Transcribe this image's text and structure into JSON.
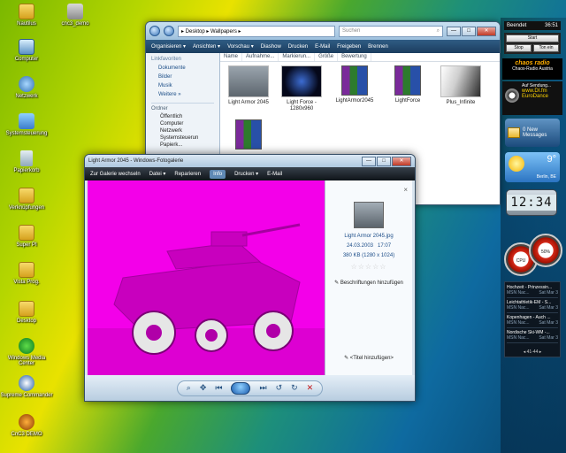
{
  "desktop_icons": [
    {
      "label": "Nautilus",
      "icon": "folder-icon"
    },
    {
      "label": "cnc3_demo",
      "icon": "shortcut-icon"
    },
    {
      "label": "Computer",
      "icon": "computer-icon"
    },
    {
      "label": "Netzwerk",
      "icon": "network-icon"
    },
    {
      "label": "Systemsteuerung",
      "icon": "control-panel-icon"
    },
    {
      "label": "Papierkorb",
      "icon": "recycle-bin-icon"
    },
    {
      "label": "Verknüpfungen",
      "icon": "folder-icon"
    },
    {
      "label": "Super PI",
      "icon": "folder-icon"
    },
    {
      "label": "Vista Prog.",
      "icon": "folder-icon"
    },
    {
      "label": "Desktop",
      "icon": "folder-icon"
    },
    {
      "label": "Windows Media Center",
      "icon": "media-center-icon"
    },
    {
      "label": "Supreme Commander",
      "icon": "game-icon"
    },
    {
      "label": "CnC3 DEMO",
      "icon": "game-icon"
    }
  ],
  "explorer": {
    "address": "▸ Desktop ▸ Wallpapers ▸",
    "search_placeholder": "Suchen",
    "toolbar": [
      "Organisieren ▾",
      "Ansichten ▾",
      "Vorschau ▾",
      "Diashow",
      "Drucken",
      "E-Mail",
      "Freigeben",
      "Brennen"
    ],
    "nav": {
      "favorites_header": "Linkfavoriten",
      "links": [
        "Dokumente",
        "Bilder",
        "Musik",
        "Weitere »"
      ],
      "folders_header": "Ordner",
      "tree": [
        "Öffentlich",
        "Computer",
        "Netzwerk",
        "Systemsteuerun",
        "Papierk..."
      ]
    },
    "columns": [
      "Name",
      "Aufnahme...",
      "Markierun...",
      "Größe",
      "Bewertung"
    ],
    "files": [
      {
        "name": "Light Armor 2045",
        "thumb": "tank"
      },
      {
        "name": "Light Force - 1280x960",
        "thumb": "space"
      },
      {
        "name": "LightArmor2045",
        "thumb": "rar"
      },
      {
        "name": "LightForce",
        "thumb": "rar"
      },
      {
        "name": "Plus_Infinite",
        "thumb": "grey"
      },
      {
        "name": "",
        "thumb": "rar"
      }
    ],
    "controls": {
      "min": "—",
      "max": "□",
      "close": "✕"
    }
  },
  "gallery": {
    "title": "Light Armor 2045 - Windows-Fotogalerie",
    "menu": {
      "back": "Zur Galerie wechseln",
      "file": "Datei ▾",
      "fix": "Reparieren",
      "info": "Info",
      "print": "Drucken ▾",
      "email": "E-Mail"
    },
    "info": {
      "filename": "Light Armor 2045.jpg",
      "date": "24.03.2003",
      "time": "17:07",
      "size": "380 KB (1280 x 1024)",
      "rating": 0,
      "add_tags": "Beschriftungen hinzufügen",
      "add_title": "<Titel hinzufügen>"
    },
    "controls": {
      "min": "—",
      "max": "□",
      "close": "✕"
    }
  },
  "sidebar": {
    "top_clock": {
      "label": "Beendet",
      "time": "36:51"
    },
    "start_gadget": {
      "start": "Start",
      "stop": "Stop",
      "tone": "Ton ein"
    },
    "radio": {
      "title": "chaos radio",
      "subtitle": "Chaos-Radio Austria"
    },
    "difm": {
      "pre": "Auf Sendung...",
      "station": "www.DI.fm EuroDance"
    },
    "mail": {
      "count": "0 New",
      "label": "Messages"
    },
    "weather": {
      "temp": "9°",
      "city": "Berlin, BE"
    },
    "clock_digital": "12:34",
    "meters": [
      "CPU",
      "50%"
    ],
    "news": [
      {
        "title": "Hochzeit - Prinzessin...",
        "source": "MSN Nac...",
        "date": "Sat Mar 3"
      },
      {
        "title": "Leichtathletik-EM - S...",
        "source": "MSN Nac...",
        "date": "Sat Mar 3"
      },
      {
        "title": "Kopenhagen - Auch ...",
        "source": "MSN Nac...",
        "date": "Sat Mar 3"
      },
      {
        "title": "Nordische Ski-WM -...",
        "source": "MSN Nac...",
        "date": "Sat Mar 3"
      }
    ],
    "news_pager": "◂  41-44  ▸"
  },
  "colors": {
    "magenta": "#f300e9",
    "toolbar_dark": "#1b3d5e",
    "accent_blue": "#1d4e89"
  }
}
